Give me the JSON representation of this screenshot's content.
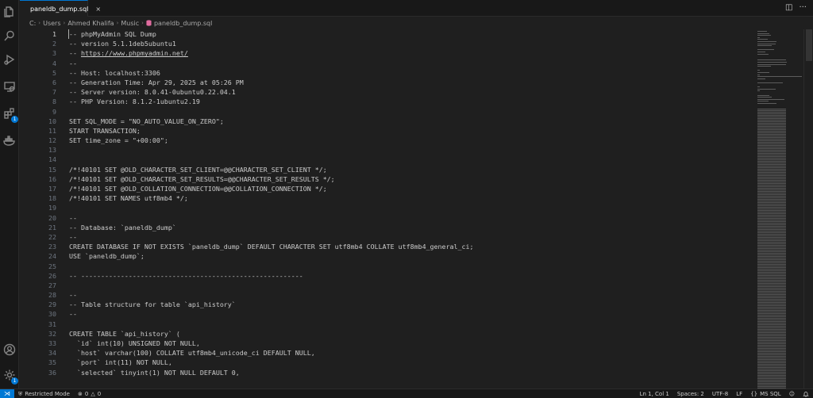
{
  "tab": {
    "label": "paneldb_dump.sql",
    "close": "×"
  },
  "tab_actions": {
    "split": "◫",
    "more": "···"
  },
  "breadcrumb": [
    "C:",
    "Users",
    "Ahmed Khalifa",
    "Music",
    "paneldb_dump.sql"
  ],
  "breadcrumb_sep": "›",
  "editor": {
    "lines": [
      "-- phpMyAdmin SQL Dump",
      "-- version 5.1.1deb5ubuntu1",
      "-- https://www.phpmyadmin.net/",
      "--",
      "-- Host: localhost:3306",
      "-- Generation Time: Apr 29, 2025 at 05:26 PM",
      "-- Server version: 8.0.41-0ubuntu0.22.04.1",
      "-- PHP Version: 8.1.2-1ubuntu2.19",
      "",
      "SET SQL_MODE = \"NO_AUTO_VALUE_ON_ZERO\";",
      "START TRANSACTION;",
      "SET time_zone = \"+00:00\";",
      "",
      "",
      "/*!40101 SET @OLD_CHARACTER_SET_CLIENT=@@CHARACTER_SET_CLIENT */;",
      "/*!40101 SET @OLD_CHARACTER_SET_RESULTS=@@CHARACTER_SET_RESULTS */;",
      "/*!40101 SET @OLD_COLLATION_CONNECTION=@@COLLATION_CONNECTION */;",
      "/*!40101 SET NAMES utf8mb4 */;",
      "",
      "--",
      "-- Database: `paneldb_dump`",
      "--",
      "CREATE DATABASE IF NOT EXISTS `paneldb_dump` DEFAULT CHARACTER SET utf8mb4 COLLATE utf8mb4_general_ci;",
      "USE `paneldb_dump`;",
      "",
      "-- --------------------------------------------------------",
      "",
      "--",
      "-- Table structure for table `api_history`",
      "--",
      "",
      "CREATE TABLE `api_history` (",
      "  `id` int(10) UNSIGNED NOT NULL,",
      "  `host` varchar(100) COLLATE utf8mb4_unicode_ci DEFAULT NULL,",
      "  `port` int(11) NOT NULL,",
      "  `selected` tinyint(1) NOT NULL DEFAULT 0,"
    ]
  },
  "statusbar": {
    "remote_icon": "⋊",
    "restricted": "Restricted Mode",
    "errors": "0",
    "warnings": "0",
    "position": "Ln 1, Col 1",
    "spaces": "Spaces: 2",
    "encoding": "UTF-8",
    "eol": "LF",
    "language_icon": "{}",
    "language": "MS SQL",
    "copilot_icon": "☺",
    "bell_icon": "🔔"
  },
  "badges": {
    "extensions": "1",
    "settings": "1"
  },
  "colors": {
    "accent": "#0078d4",
    "background": "#1f1f1f",
    "tab_icon": "#e06c9f"
  }
}
